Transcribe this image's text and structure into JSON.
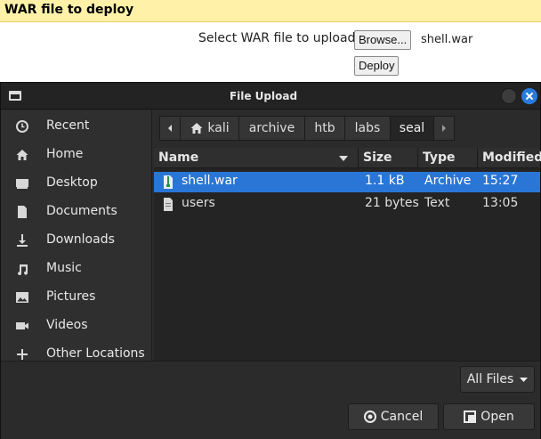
{
  "web": {
    "header": "WAR file to deploy",
    "select_label": "Select WAR file to upload",
    "browse_label": "Browse...",
    "selected_file": "shell.war",
    "deploy_label": "Deploy"
  },
  "dialog": {
    "title": "File Upload",
    "sidebar": [
      {
        "label": "Recent",
        "icon": "clock-icon"
      },
      {
        "label": "Home",
        "icon": "home-icon"
      },
      {
        "label": "Desktop",
        "icon": "desktop-icon"
      },
      {
        "label": "Documents",
        "icon": "document-icon"
      },
      {
        "label": "Downloads",
        "icon": "download-icon"
      },
      {
        "label": "Music",
        "icon": "music-icon"
      },
      {
        "label": "Pictures",
        "icon": "picture-icon"
      },
      {
        "label": "Videos",
        "icon": "video-icon"
      },
      {
        "label": "Other Locations",
        "icon": "plus-icon"
      }
    ],
    "path": [
      "kali",
      "archive",
      "htb",
      "labs",
      "seal"
    ],
    "columns": {
      "name": "Name",
      "size": "Size",
      "type": "Type",
      "modified": "Modified"
    },
    "files": [
      {
        "name": "shell.war",
        "size": "1.1 kB",
        "type": "Archive",
        "modified": "15:27",
        "selected": true
      },
      {
        "name": "users",
        "size": "21 bytes",
        "type": "Text",
        "modified": "13:05",
        "selected": false
      }
    ],
    "filter": "All Files",
    "cancel_label": "Cancel",
    "open_label": "Open"
  }
}
